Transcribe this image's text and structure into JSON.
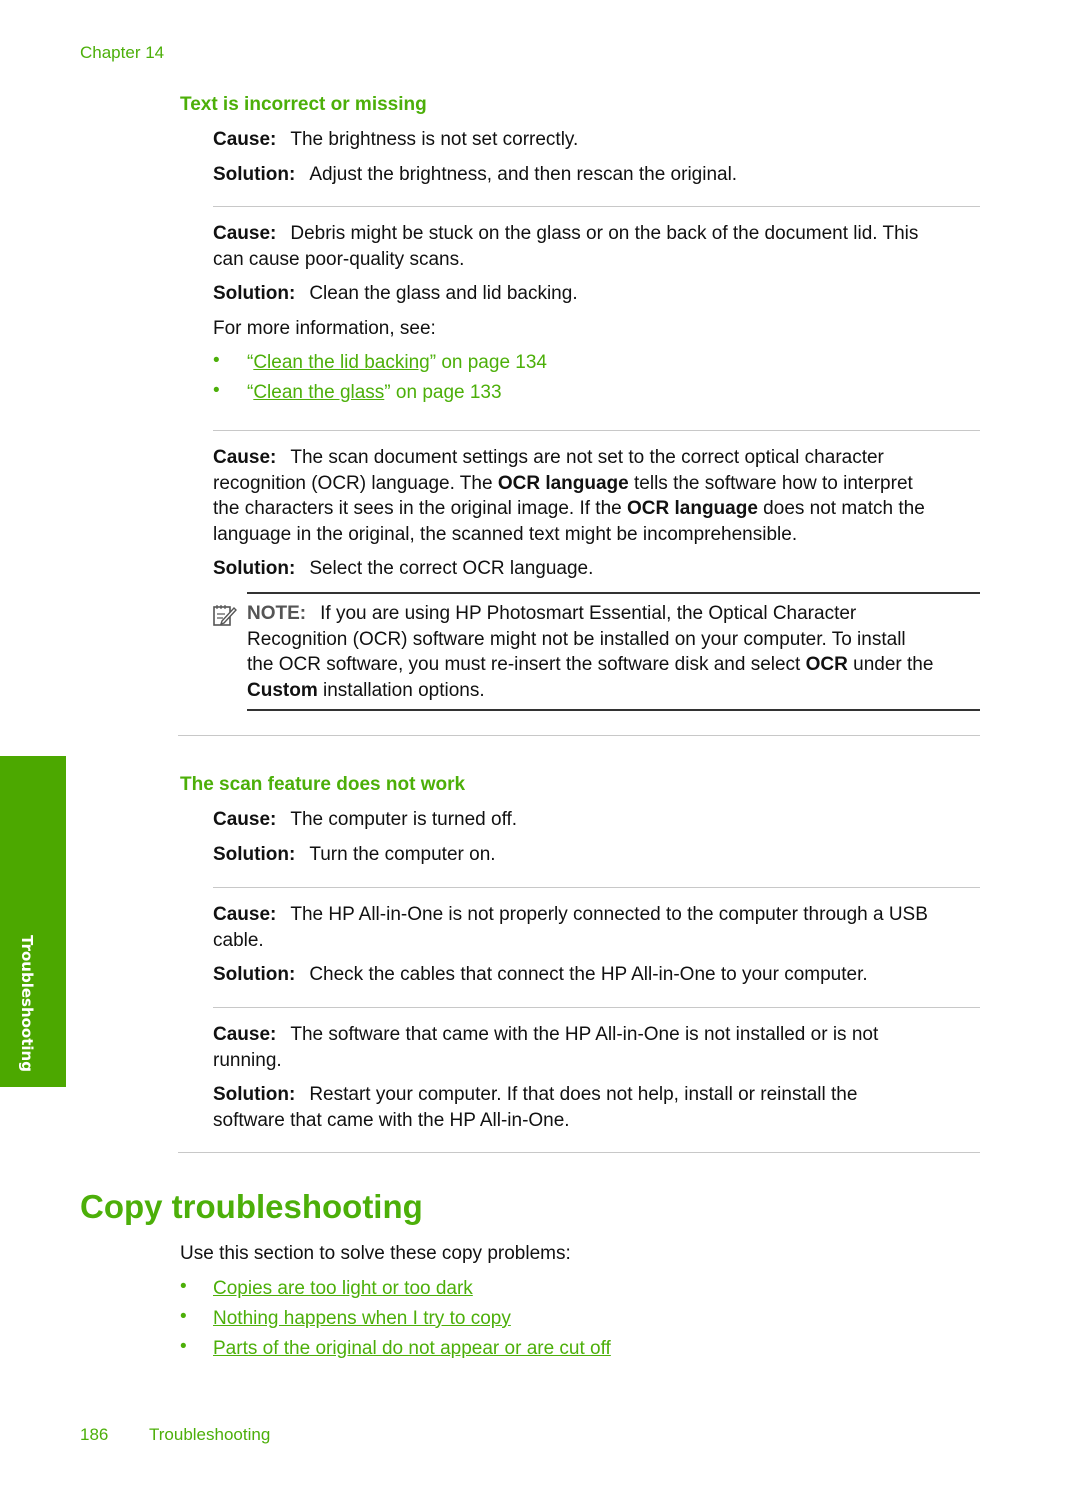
{
  "header": {
    "chapter": "Chapter 14"
  },
  "sections": {
    "text_incorrect": {
      "title": "Text is incorrect or missing",
      "items": [
        {
          "cause_label": "Cause:",
          "cause": "The brightness is not set correctly.",
          "solution_label": "Solution:",
          "solution": "Adjust the brightness, and then rescan the original."
        },
        {
          "cause_label": "Cause:",
          "cause_line1": "Debris might be stuck on the glass or on the back of the document lid. This",
          "cause_line2": "can cause poor-quality scans.",
          "solution_label": "Solution:",
          "solution": "Clean the glass and lid backing.",
          "more_info": "For more information, see:",
          "links": [
            {
              "open_quote": "“",
              "text": "Clean the lid backing",
              "close": "” on page 134"
            },
            {
              "open_quote": "“",
              "text": "Clean the glass",
              "close": "” on page 133"
            }
          ]
        },
        {
          "cause_label": "Cause:",
          "cause_line1": "The scan document settings are not set to the correct optical character",
          "cause_line2_a": "recognition (OCR) language. The ",
          "cause_line2_b": "OCR language",
          "cause_line2_c": " tells the software how to interpret",
          "cause_line3_a": "the characters it sees in the original image. If the ",
          "cause_line3_b": "OCR language",
          "cause_line3_c": " does not match the",
          "cause_line4": "language in the original, the scanned text might be incomprehensible.",
          "solution_label": "Solution:",
          "solution": "Select the correct OCR language.",
          "note": {
            "label": "NOTE:",
            "line1": "If you are using HP Photosmart Essential, the Optical Character",
            "line2": "Recognition (OCR) software might not be installed on your computer. To install",
            "line3_a": "the OCR software, you must re-insert the software disk and select ",
            "line3_b": "OCR",
            "line3_c": " under the",
            "line4_a": "Custom",
            "line4_b": " installation options."
          }
        }
      ]
    },
    "scan_not_work": {
      "title": "The scan feature does not work",
      "items": [
        {
          "cause_label": "Cause:",
          "cause": "The computer is turned off.",
          "solution_label": "Solution:",
          "solution": "Turn the computer on."
        },
        {
          "cause_label": "Cause:",
          "cause_line1": "The HP All-in-One is not properly connected to the computer through a USB",
          "cause_line2": "cable.",
          "solution_label": "Solution:",
          "solution": "Check the cables that connect the HP All-in-One to your computer."
        },
        {
          "cause_label": "Cause:",
          "cause_line1": "The software that came with the HP All-in-One is not installed or is not",
          "cause_line2": "running.",
          "solution_label": "Solution:",
          "solution_line1": "Restart your computer. If that does not help, install or reinstall the",
          "solution_line2": "software that came with the HP All-in-One."
        }
      ]
    }
  },
  "copy": {
    "title": "Copy troubleshooting",
    "intro": "Use this section to solve these copy problems:",
    "links": [
      "Copies are too light or too dark",
      "Nothing happens when I try to copy",
      "Parts of the original do not appear or are cut off"
    ]
  },
  "sidetab": {
    "label": "Troubleshooting"
  },
  "footer": {
    "page": "186",
    "section": "Troubleshooting"
  },
  "colors": {
    "accent": "#4caf09",
    "tab": "#4ca800"
  }
}
